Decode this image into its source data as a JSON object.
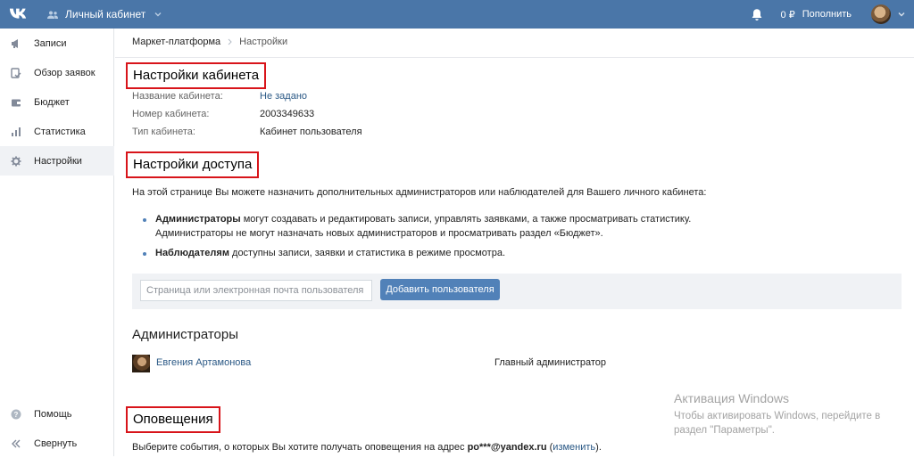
{
  "header": {
    "cabinet_label": "Личный кабинет",
    "balance": "0 ₽",
    "topup_label": "Пополнить"
  },
  "sidebar": {
    "items": [
      {
        "label": "Записи",
        "icon": "megaphone-icon"
      },
      {
        "label": "Обзор заявок",
        "icon": "checklist-icon"
      },
      {
        "label": "Бюджет",
        "icon": "wallet-icon"
      },
      {
        "label": "Статистика",
        "icon": "bar-chart-icon"
      },
      {
        "label": "Настройки",
        "icon": "gear-icon",
        "active": true
      }
    ],
    "bottom": [
      {
        "label": "Помощь",
        "icon": "help-icon"
      },
      {
        "label": "Свернуть",
        "icon": "collapse-icon"
      }
    ]
  },
  "breadcrumb": [
    "Маркет-платформа",
    "Настройки"
  ],
  "cabinet_settings": {
    "title": "Настройки кабинета",
    "rows": [
      {
        "label": "Название кабинета:",
        "value": "Не задано"
      },
      {
        "label": "Номер кабинета:",
        "value": "2003349633"
      },
      {
        "label": "Тип кабинета:",
        "value": "Кабинет пользователя"
      }
    ]
  },
  "access_settings": {
    "title": "Настройки доступа",
    "intro": "На этой странице Вы можете назначить дополнительных администраторов или наблюдателей для Вашего личного кабинета:",
    "bullet1_bold": "Администраторы",
    "bullet1_rest": " могут создавать и редактировать записи, управлять заявками, а также просматривать статистику.",
    "bullet1_line2": "Администраторы не могут назначать новых администраторов и просматривать раздел «Бюджет».",
    "bullet2_bold": "Наблюдателям",
    "bullet2_rest": " доступны записи, заявки и статистика в режиме просмотра.",
    "input_placeholder": "Страница или электронная почта пользователя",
    "add_button": "Добавить пользователя"
  },
  "administrators": {
    "title": "Администраторы",
    "list": [
      {
        "name": "Евгения Артамонова",
        "role": "Главный администратор"
      }
    ]
  },
  "notifications": {
    "title": "Оповещения",
    "text_before": "Выберите события, о которых Вы хотите получать оповещения на адрес ",
    "email": "ро***@yandex.ru",
    "paren_open": " (",
    "change_link": "изменить",
    "paren_close": ")."
  },
  "windows_activation": {
    "title": "Активация Windows",
    "line1": "Чтобы активировать Windows, перейдите в",
    "line2": "раздел \"Параметры\"."
  }
}
